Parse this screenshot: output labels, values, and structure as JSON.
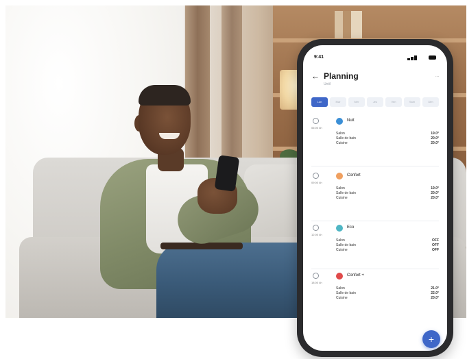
{
  "status_bar": {
    "time": "9:41"
  },
  "header": {
    "back_icon": "arrow-left-icon",
    "title": "Planning",
    "subtitle": "Until",
    "more_label": "..."
  },
  "days": [
    "Lun",
    "Mar",
    "Mer",
    "Jeu",
    "Ven",
    "Sam",
    "Dim"
  ],
  "active_day": 0,
  "cards": [
    {
      "date": "06:00 4h",
      "mode": "Nuit",
      "mode_color": "#3b8fd6",
      "rows": [
        {
          "label": "Salon",
          "value": "19.0°"
        },
        {
          "label": "Salle de bain",
          "value": "20.0°"
        },
        {
          "label": "Cuisine",
          "value": "20.0°"
        }
      ]
    },
    {
      "date": "09:00 4h",
      "mode": "Confort",
      "mode_color": "#f0a060",
      "rows": [
        {
          "label": "Salon",
          "value": "19.0°"
        },
        {
          "label": "Salle de bain",
          "value": "20.0°"
        },
        {
          "label": "Cuisine",
          "value": "20.0°"
        }
      ]
    },
    {
      "date": "12:00 4h",
      "mode": "Eco",
      "mode_color": "#4fb6c4",
      "rows": [
        {
          "label": "Salon",
          "value": "OFF"
        },
        {
          "label": "Salle de bain",
          "value": "OFF"
        },
        {
          "label": "Cuisine",
          "value": "OFF"
        }
      ]
    },
    {
      "date": "18:00 4h",
      "mode": "Confort +",
      "mode_color": "#e04a4a",
      "rows": [
        {
          "label": "Salon",
          "value": "21.0°"
        },
        {
          "label": "Salle de bain",
          "value": "22.0°"
        },
        {
          "label": "Cuisine",
          "value": "20.0°"
        }
      ]
    }
  ],
  "fab_label": "+",
  "colors": {
    "accent": "#3f67c8",
    "phone_frame": "#2b2b2d"
  }
}
